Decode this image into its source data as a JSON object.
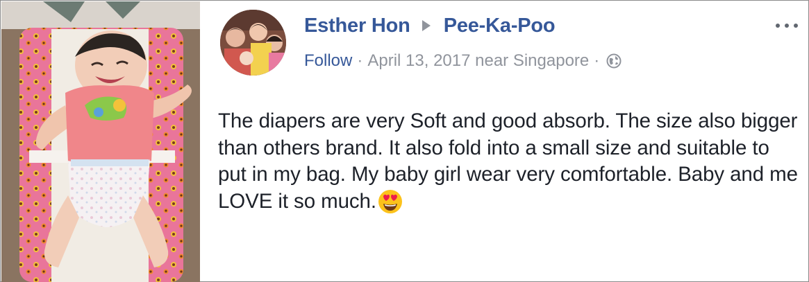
{
  "post": {
    "author": "Esther Hon",
    "page": "Pee-Ka-Poo",
    "follow_label": "Follow",
    "separator": "·",
    "date_location": "April 13, 2017 near Singapore",
    "body": "The diapers are very Soft and good absorb. The size also bigger than others brand. It also fold into a small size and suitable to put in my bag. My baby girl wear very comfortable. Baby and me LOVE it so much.",
    "icons": {
      "arrow": "right-triangle-icon",
      "privacy": "globe-icon",
      "more": "more-options-icon",
      "emoji": "heart-eyes-emoji"
    }
  },
  "colors": {
    "link": "#365899",
    "meta": "#90949c",
    "text": "#1d2129"
  }
}
